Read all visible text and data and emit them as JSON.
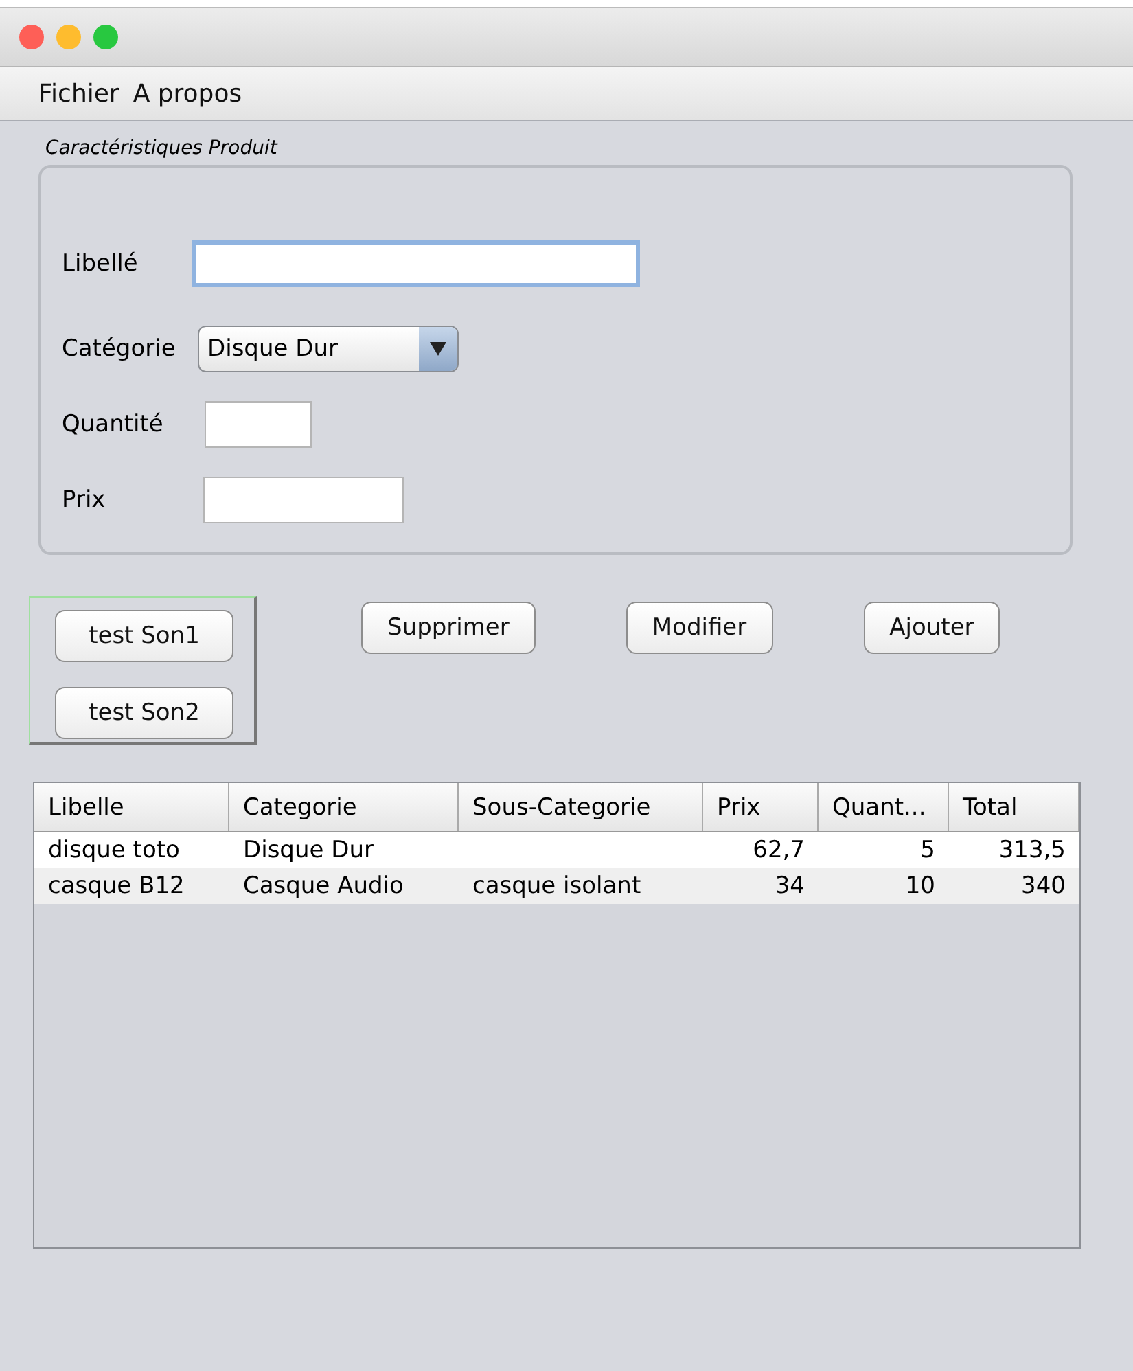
{
  "menu": [
    "Fichier",
    "A propos"
  ],
  "group": {
    "title": "Caractéristiques Produit",
    "fields": [
      {
        "kind": "text",
        "label": "Libellé",
        "focused": true
      },
      {
        "kind": "select",
        "label": "Catégorie",
        "value": "Disque Dur"
      },
      {
        "kind": "text",
        "label": "Quantité",
        "focused": false
      },
      {
        "kind": "text",
        "label": "Prix",
        "focused": false
      }
    ]
  },
  "side_buttons": [
    "test Son1",
    "test Son2"
  ],
  "actions": [
    "Supprimer",
    "Modifier",
    "Ajouter"
  ],
  "table": {
    "columns": [
      "Libelle",
      "Categorie",
      "Sous-Categorie",
      "Prix",
      "Quant...",
      "Total"
    ],
    "rows": [
      [
        "disque toto",
        "Disque Dur",
        "",
        "62,7",
        "5",
        "313,5"
      ],
      [
        "casque B12",
        "Casque Audio",
        "casque isolant",
        "34",
        "10",
        "340"
      ]
    ]
  }
}
